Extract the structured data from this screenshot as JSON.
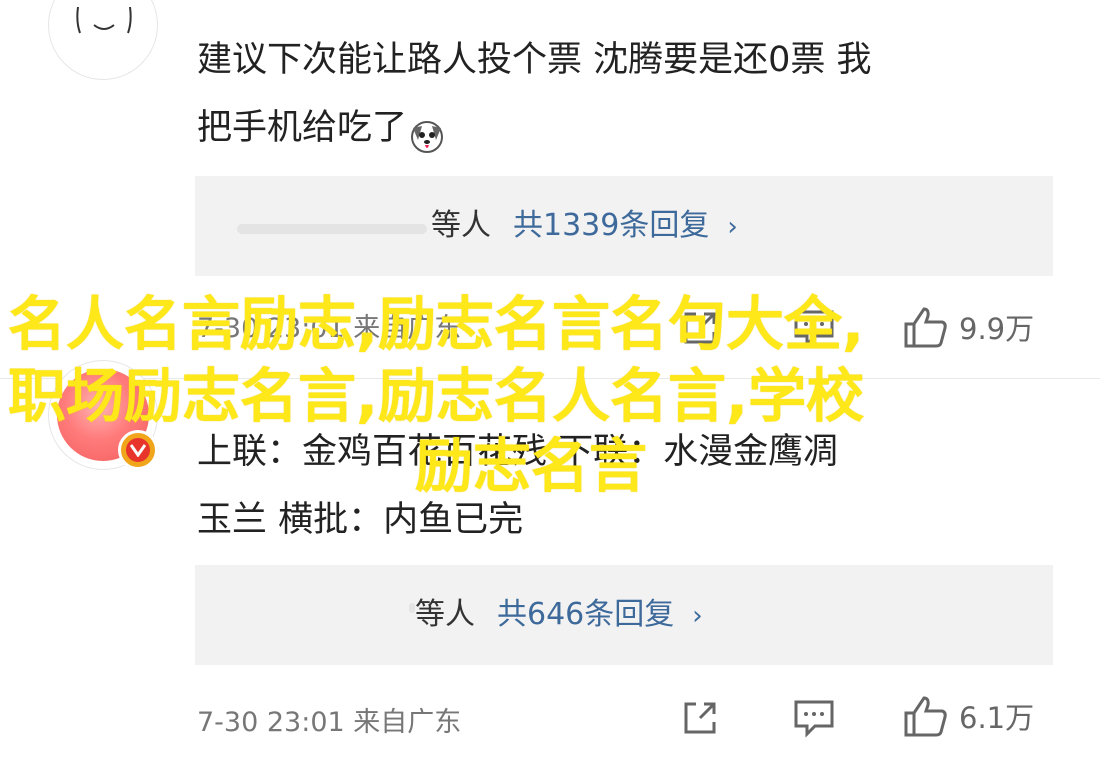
{
  "comments": [
    {
      "text_line1": "建议下次能让路人投个票 沈腾要是还0票 我",
      "text_line2": "把手机给吃了",
      "emoji_icon": "dog-face-emoji-icon",
      "replies": {
        "people": "等人",
        "count_label": "共1339条回复",
        "chevron": "›"
      },
      "meta": {
        "time_source": "7-30 23:01 来自广东",
        "likes": "9.9万"
      }
    },
    {
      "text_line1": "上联：金鸡百花百花残 下联：水漫金鹰凋",
      "text_line2": "玉兰 横批：内鱼已完",
      "replies": {
        "people": "等人",
        "count_label": "共646条回复",
        "chevron": "›"
      },
      "meta": {
        "time_source": "7-30 23:01 来自广东",
        "likes": "6.1万"
      }
    }
  ],
  "overlay": {
    "line1": "名人名言励志,励志名言名句大全,",
    "line2": "职场励志名言,励志名人名言,学校",
    "line3": "励志名言",
    "color": "#ffe81a"
  },
  "colors": {
    "link": "#3e6a9b",
    "meta": "#777777",
    "reply_bg": "#f2f2f2"
  }
}
